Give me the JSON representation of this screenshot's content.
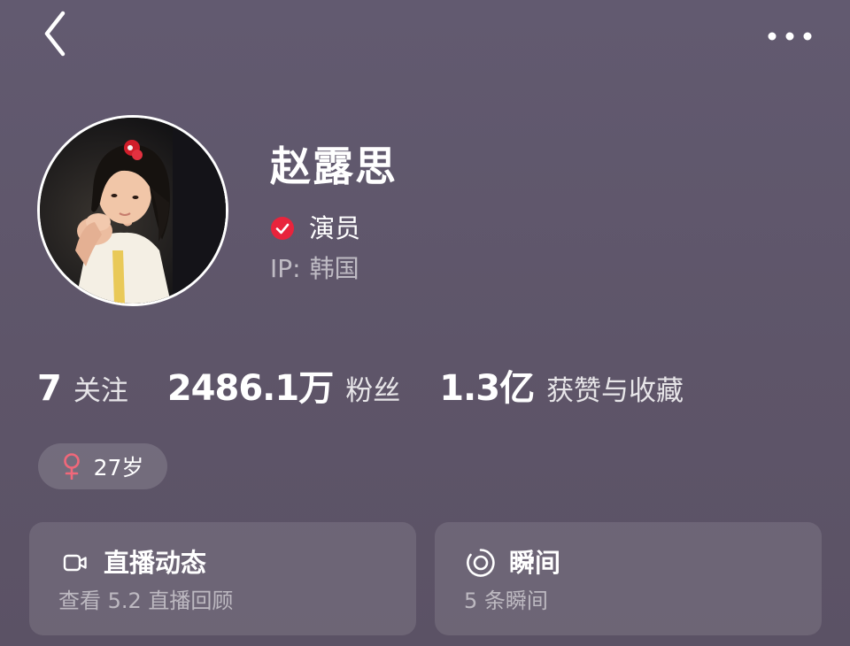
{
  "topbar": {
    "back_icon": "chevron-left-icon",
    "more_icon": "more-horizontal-icon"
  },
  "profile": {
    "name": "赵露思",
    "verified_icon": "verified-check-icon",
    "verified_color": "#e8243c",
    "title": "演员",
    "ip_label": "IP:",
    "ip_value": "韩国"
  },
  "stats": {
    "following_value": "7",
    "following_label": "关注",
    "followers_value": "2486.1万",
    "followers_label": "粉丝",
    "likes_value": "1.3亿",
    "likes_label": "获赞与收藏"
  },
  "tags": {
    "gender_icon": "female-icon",
    "gender_color": "#f0687a",
    "age": "27岁"
  },
  "cards": {
    "live": {
      "icon": "video-camera-icon",
      "title": "直播动态",
      "subtitle": "查看 5.2 直播回顾"
    },
    "moments": {
      "icon": "moments-ring-icon",
      "title": "瞬间",
      "subtitle": "5 条瞬间"
    }
  },
  "colors": {
    "background": "#5f566c",
    "text": "#ffffff"
  }
}
